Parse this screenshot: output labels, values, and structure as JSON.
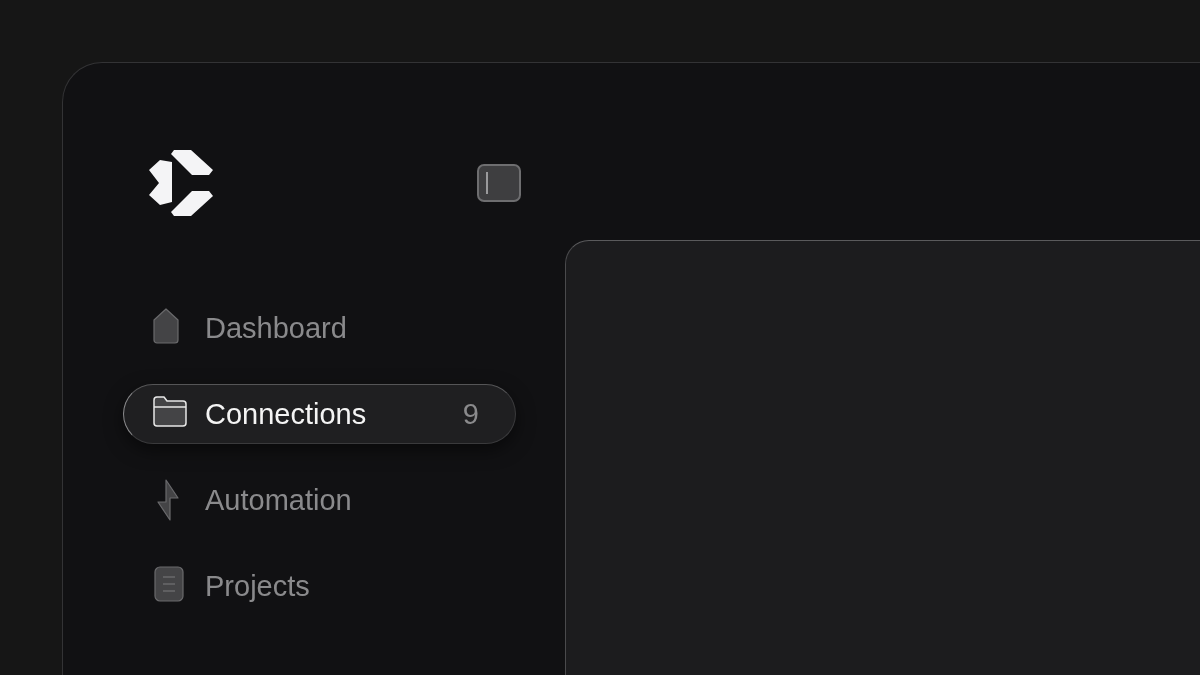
{
  "sidebar": {
    "nav": [
      {
        "label": "Dashboard",
        "kind": "home",
        "selected": false
      },
      {
        "label": "Connections",
        "kind": "folder",
        "selected": true,
        "count": "9"
      },
      {
        "label": "Automation",
        "kind": "bolt",
        "selected": false
      },
      {
        "label": "Projects",
        "kind": "document",
        "selected": false
      }
    ]
  }
}
